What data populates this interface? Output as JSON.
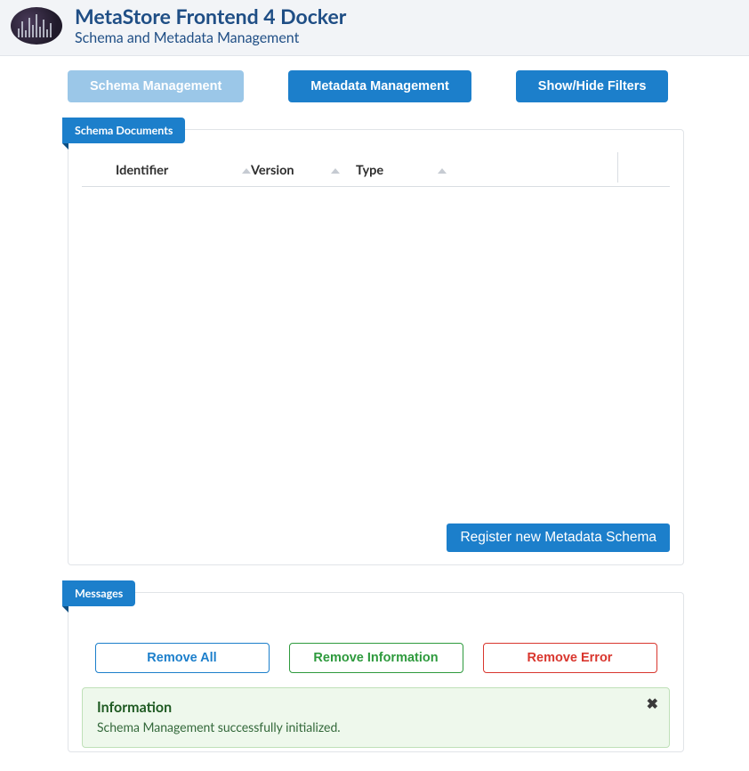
{
  "header": {
    "title": "MetaStore Frontend 4 Docker",
    "subtitle": "Schema and Metadata Management"
  },
  "tabs": {
    "schema": "Schema Management",
    "metadata": "Metadata Management",
    "filters": "Show/Hide Filters"
  },
  "schema_panel": {
    "ribbon": "Schema Documents",
    "columns": {
      "identifier": "Identifier",
      "version": "Version",
      "type": "Type"
    },
    "rows": [],
    "register_btn": "Register new Metadata Schema"
  },
  "messages_panel": {
    "ribbon": "Messages",
    "buttons": {
      "remove_all": "Remove All",
      "remove_info": "Remove Information",
      "remove_error": "Remove Error"
    },
    "alert": {
      "title": "Information",
      "body": "Schema Management successfully initialized."
    }
  },
  "colors": {
    "brand_blue": "#1c7fcb",
    "light_blue": "#9bc7e8",
    "success_green": "#2e9a3d",
    "error_red": "#d9362e"
  }
}
